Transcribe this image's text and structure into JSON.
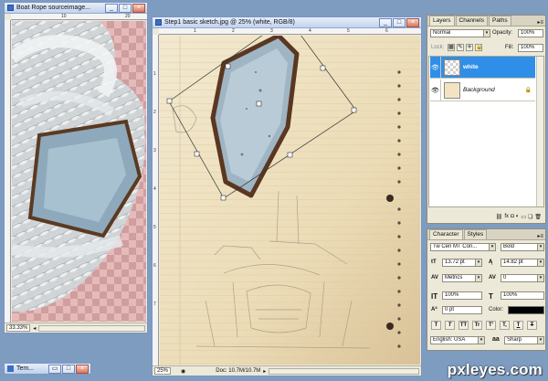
{
  "colors": {
    "selection": "#2f8fe8",
    "paper": "#efe3c5",
    "rope_tint": "#d7a9a9"
  },
  "rope_window": {
    "title": "Boat Rope sourceimage...",
    "zoom": "33.33%",
    "ruler_labels": [
      "10",
      "20"
    ]
  },
  "sketch_window": {
    "title": "Step1 basic sketch.jpg @ 25% (white, RGB/8)",
    "zoom": "25%",
    "doc_info": "Doc: 10.7M/10.7M",
    "ruler_labels": [
      "1",
      "2",
      "3",
      "4",
      "5",
      "6"
    ],
    "vruler_labels": [
      "1",
      "2",
      "3",
      "4",
      "5",
      "6",
      "7"
    ]
  },
  "taskbar": {
    "temp_label": "Tem..."
  },
  "layers_panel": {
    "tabs": [
      "Layers",
      "Channels",
      "Paths"
    ],
    "blend_mode": "Normal",
    "opacity_label": "Opacity:",
    "opacity_value": "100%",
    "lock_label": "Lock:",
    "fill_label": "Fill:",
    "fill_value": "100%",
    "layers": [
      {
        "name": "white",
        "selected": true
      },
      {
        "name": "Background",
        "selected": false
      }
    ]
  },
  "character_panel": {
    "tabs": [
      "Character",
      "Styles"
    ],
    "font_family": "Tw Cen MT Con...",
    "font_style": "Bold",
    "font_size": "13.72 pt",
    "leading": "14.82 pt",
    "kerning": "Metrics",
    "tracking": "0",
    "vscale": "100%",
    "hscale": "100%",
    "baseline": "0 pt",
    "color_label": "Color:",
    "color_value": "#000000",
    "format_buttons": [
      "T",
      "T",
      "TT",
      "Tr",
      "T'",
      "T,",
      "T",
      "T"
    ],
    "language": "English: USA",
    "aa_label": "aa",
    "antialias": "Sharp"
  },
  "watermark": "pxleyes.com"
}
